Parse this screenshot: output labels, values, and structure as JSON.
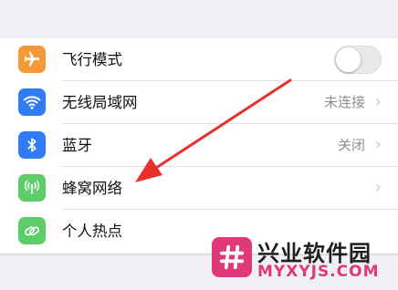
{
  "settings": {
    "airplane": {
      "label": "飞行模式",
      "icon": "airplane-icon",
      "color": "#f3993a",
      "toggle_on": false
    },
    "wifi": {
      "label": "无线局域网",
      "value": "未连接",
      "icon": "wifi-icon",
      "color": "#2f7cf6"
    },
    "bluetooth": {
      "label": "蓝牙",
      "value": "关闭",
      "icon": "bluetooth-icon",
      "color": "#2f7cf6"
    },
    "cellular": {
      "label": "蜂窝网络",
      "icon": "cellular-antenna-icon",
      "color": "#5ccd67"
    },
    "hotspot": {
      "label": "个人热点",
      "icon": "hotspot-link-icon",
      "color": "#5ccd67"
    },
    "chevron": "›"
  },
  "annotation": {
    "arrow_color": "#e8302c",
    "icon": "red-arrow-pointer"
  },
  "watermark": {
    "title": "兴业软件园",
    "url": "MYXYJS.COM",
    "logo_color": "#e0397a",
    "icon": "hash-logo-icon"
  }
}
